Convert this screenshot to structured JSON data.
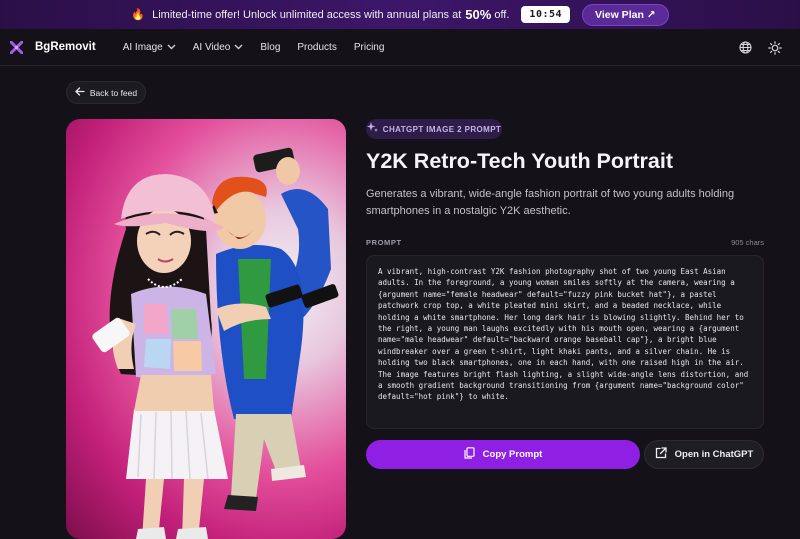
{
  "promo": {
    "fire_icon": "fire-icon",
    "text": "Limited-time offer! Unlock unlimited access with annual plans at",
    "percent": "50%",
    "suffix": "off.",
    "timer": "10:54",
    "cta": "View Plan ↗"
  },
  "nav": {
    "brand": "BgRemovit",
    "items": [
      {
        "label": "AI Image",
        "dropdown": true
      },
      {
        "label": "AI Video",
        "dropdown": true
      },
      {
        "label": "Blog",
        "dropdown": false
      },
      {
        "label": "Products",
        "dropdown": false
      },
      {
        "label": "Pricing",
        "dropdown": false
      }
    ]
  },
  "back": {
    "label": "Back to feed"
  },
  "badge": {
    "label": "CHATGPT IMAGE 2 PROMPT"
  },
  "title": "Y2K Retro-Tech Youth Portrait",
  "description": "Generates a vibrant, wide-angle fashion portrait of two young adults holding smartphones in a nostalgic Y2K aesthetic.",
  "prompt": {
    "label": "PROMPT",
    "chars": "905 chars",
    "text": "A vibrant, high-contrast Y2K fashion photography shot of two young East Asian adults. In the foreground, a young woman smiles softly at the camera, wearing a {argument name=\"female headwear\" default=\"fuzzy pink bucket hat\"}, a pastel patchwork crop top, a white pleated mini skirt, and a beaded necklace, while holding a white smartphone. Her long dark hair is blowing slightly. Behind her to the right, a young man laughs excitedly with his mouth open, wearing a {argument name=\"male headwear\" default=\"backward orange baseball cap\"}, a bright blue windbreaker over a green t-shirt, light khaki pants, and a silver chain. He is holding two black smartphones, one in each hand, with one raised high in the air. The image features bright flash lighting, a slight wide-angle lens distortion, and a smooth gradient background transitioning from {argument name=\"background color\" default=\"hot pink\"} to white."
  },
  "buttons": {
    "copy": "Copy Prompt",
    "open": "Open in ChatGPT"
  },
  "colors": {
    "accent": "#8f1fe3",
    "background": "#141218",
    "banner": "#3d166a"
  }
}
